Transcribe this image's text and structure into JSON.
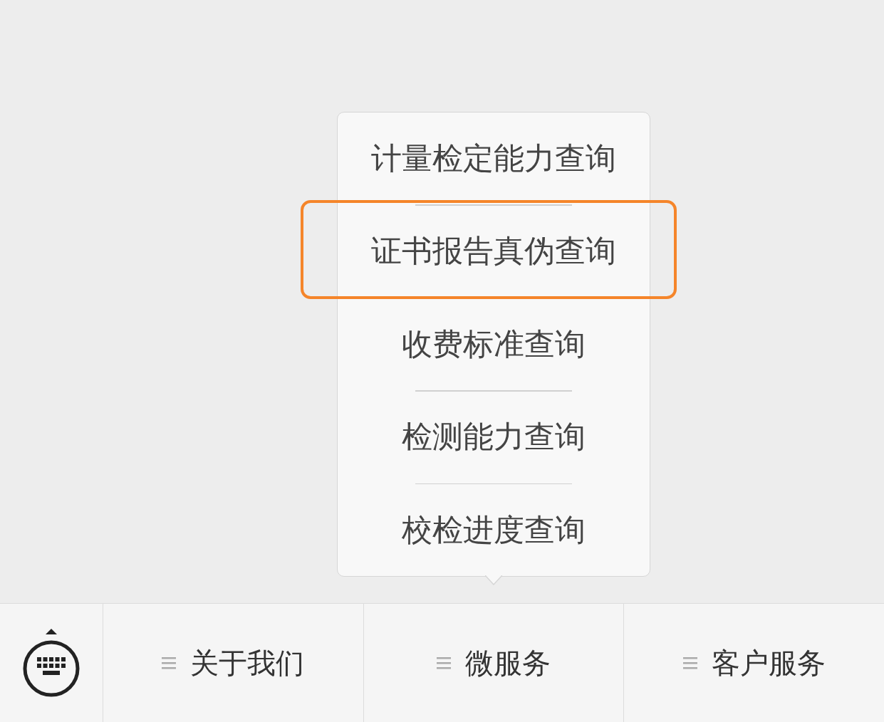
{
  "popup_menu": {
    "items": [
      {
        "label": "计量检定能力查询",
        "highlighted": false
      },
      {
        "label": "证书报告真伪查询",
        "highlighted": true
      },
      {
        "label": "收费标准查询",
        "highlighted": false
      },
      {
        "label": "检测能力查询",
        "highlighted": false
      },
      {
        "label": "校检进度查询",
        "highlighted": false
      }
    ]
  },
  "bottom_bar": {
    "tabs": [
      {
        "label": "关于我们"
      },
      {
        "label": "微服务"
      },
      {
        "label": "客户服务"
      }
    ]
  }
}
